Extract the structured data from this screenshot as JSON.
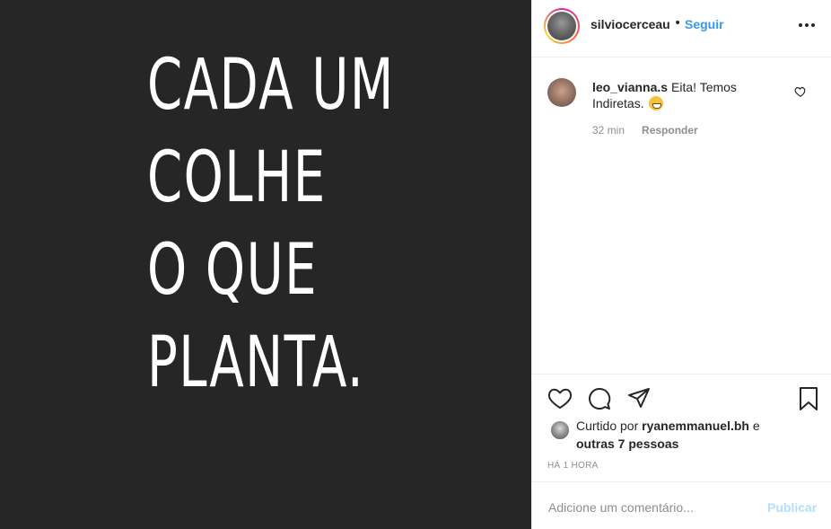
{
  "post": {
    "quote_lines": [
      "CADA UM",
      "COLHE",
      "O QUE",
      "PLANTA."
    ],
    "background_color": "#262626",
    "text_color": "#ffffff"
  },
  "header": {
    "username": "silviocerceau",
    "separator": "•",
    "follow_label": "Seguir",
    "more_icon": "more-options-icon"
  },
  "comments": [
    {
      "username": "leo_vianna.s",
      "text": "Eita! Temos Indiretas.",
      "emoji": "grinning-face",
      "time": "32 min",
      "reply_label": "Responder"
    }
  ],
  "actions": {
    "like_icon": "heart-icon",
    "comment_icon": "comment-icon",
    "share_icon": "share-icon",
    "save_icon": "bookmark-icon"
  },
  "likes": {
    "prefix": "Curtido por",
    "liker": "ryanemmanuel.bh",
    "conjunction": "e",
    "others": "outras 7 pessoas"
  },
  "timestamp": "HÁ 1 HORA",
  "add_comment": {
    "placeholder": "Adicione um comentário...",
    "publish_label": "Publicar"
  },
  "colors": {
    "accent": "#3897f0",
    "publish_disabled": "#b2dffc",
    "muted": "#8e8e8e",
    "border": "#efefef"
  }
}
